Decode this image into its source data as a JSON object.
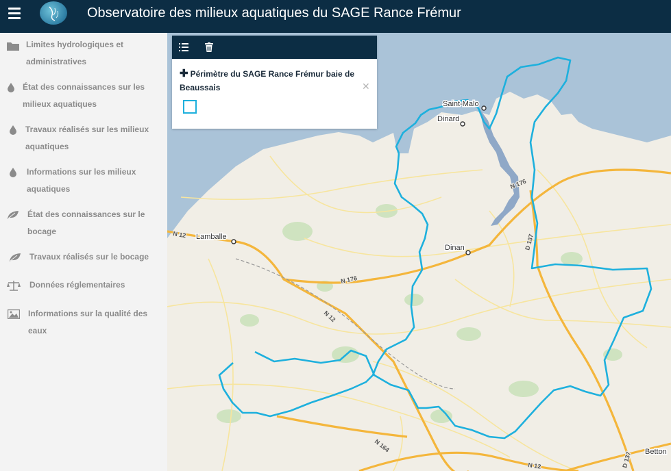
{
  "header": {
    "title": "Observatoire des milieux aquatiques du SAGE Rance Frémur",
    "menu_icon": "hamburger-menu-icon",
    "logo": "sage-logo"
  },
  "sidebar": {
    "items": [
      {
        "icon": "folder-icon",
        "label": "Limites hydrologiques et administratives"
      },
      {
        "icon": "water-drop-icon",
        "label": "État des connaissances sur les milieux aquatiques"
      },
      {
        "icon": "water-drop-icon",
        "label": "Travaux réalisés sur les milieux aquatiques"
      },
      {
        "icon": "water-drop-icon",
        "label": "Informations sur les milieux aquatiques"
      },
      {
        "icon": "leaf-icon",
        "label": "État des connaissances sur le bocage"
      },
      {
        "icon": "leaf-icon",
        "label": "Travaux réalisés sur le bocage"
      },
      {
        "icon": "balance-scale-icon",
        "label": "Données réglementaires"
      },
      {
        "icon": "image-icon",
        "label": "Informations sur la qualité des eaux"
      }
    ]
  },
  "layer_panel": {
    "list_icon": "list-icon",
    "trash_icon": "trash-icon",
    "layer_label": "Périmètre du SAGE Rance Frémur baie de Beaussais",
    "close_symbol": "✕",
    "plus_symbol": "✚",
    "legend_color": "#1eb0dd"
  },
  "map": {
    "places": {
      "saint_malo": "Saint-Malo",
      "dinard": "Dinard",
      "dinan": "Dinan",
      "lamballe": "Lamballe",
      "betton": "Betton"
    },
    "roads": {
      "n12_west": "N 12",
      "n176_mid": "N 176",
      "n176_east": "N 176",
      "n12_mid": "N 12",
      "d137_north": "D 137",
      "n164": "N 164",
      "n12_south": "N 12",
      "d137_south": "D 137"
    },
    "colors": {
      "sea": "#aac3d8",
      "land": "#f1eee6",
      "boundary": "#1eb0dd",
      "major_road": "#f4b63c",
      "minor_road": "#f7e59e",
      "estuary": "#8fa8c7",
      "woods": "#cfe3c0"
    }
  }
}
